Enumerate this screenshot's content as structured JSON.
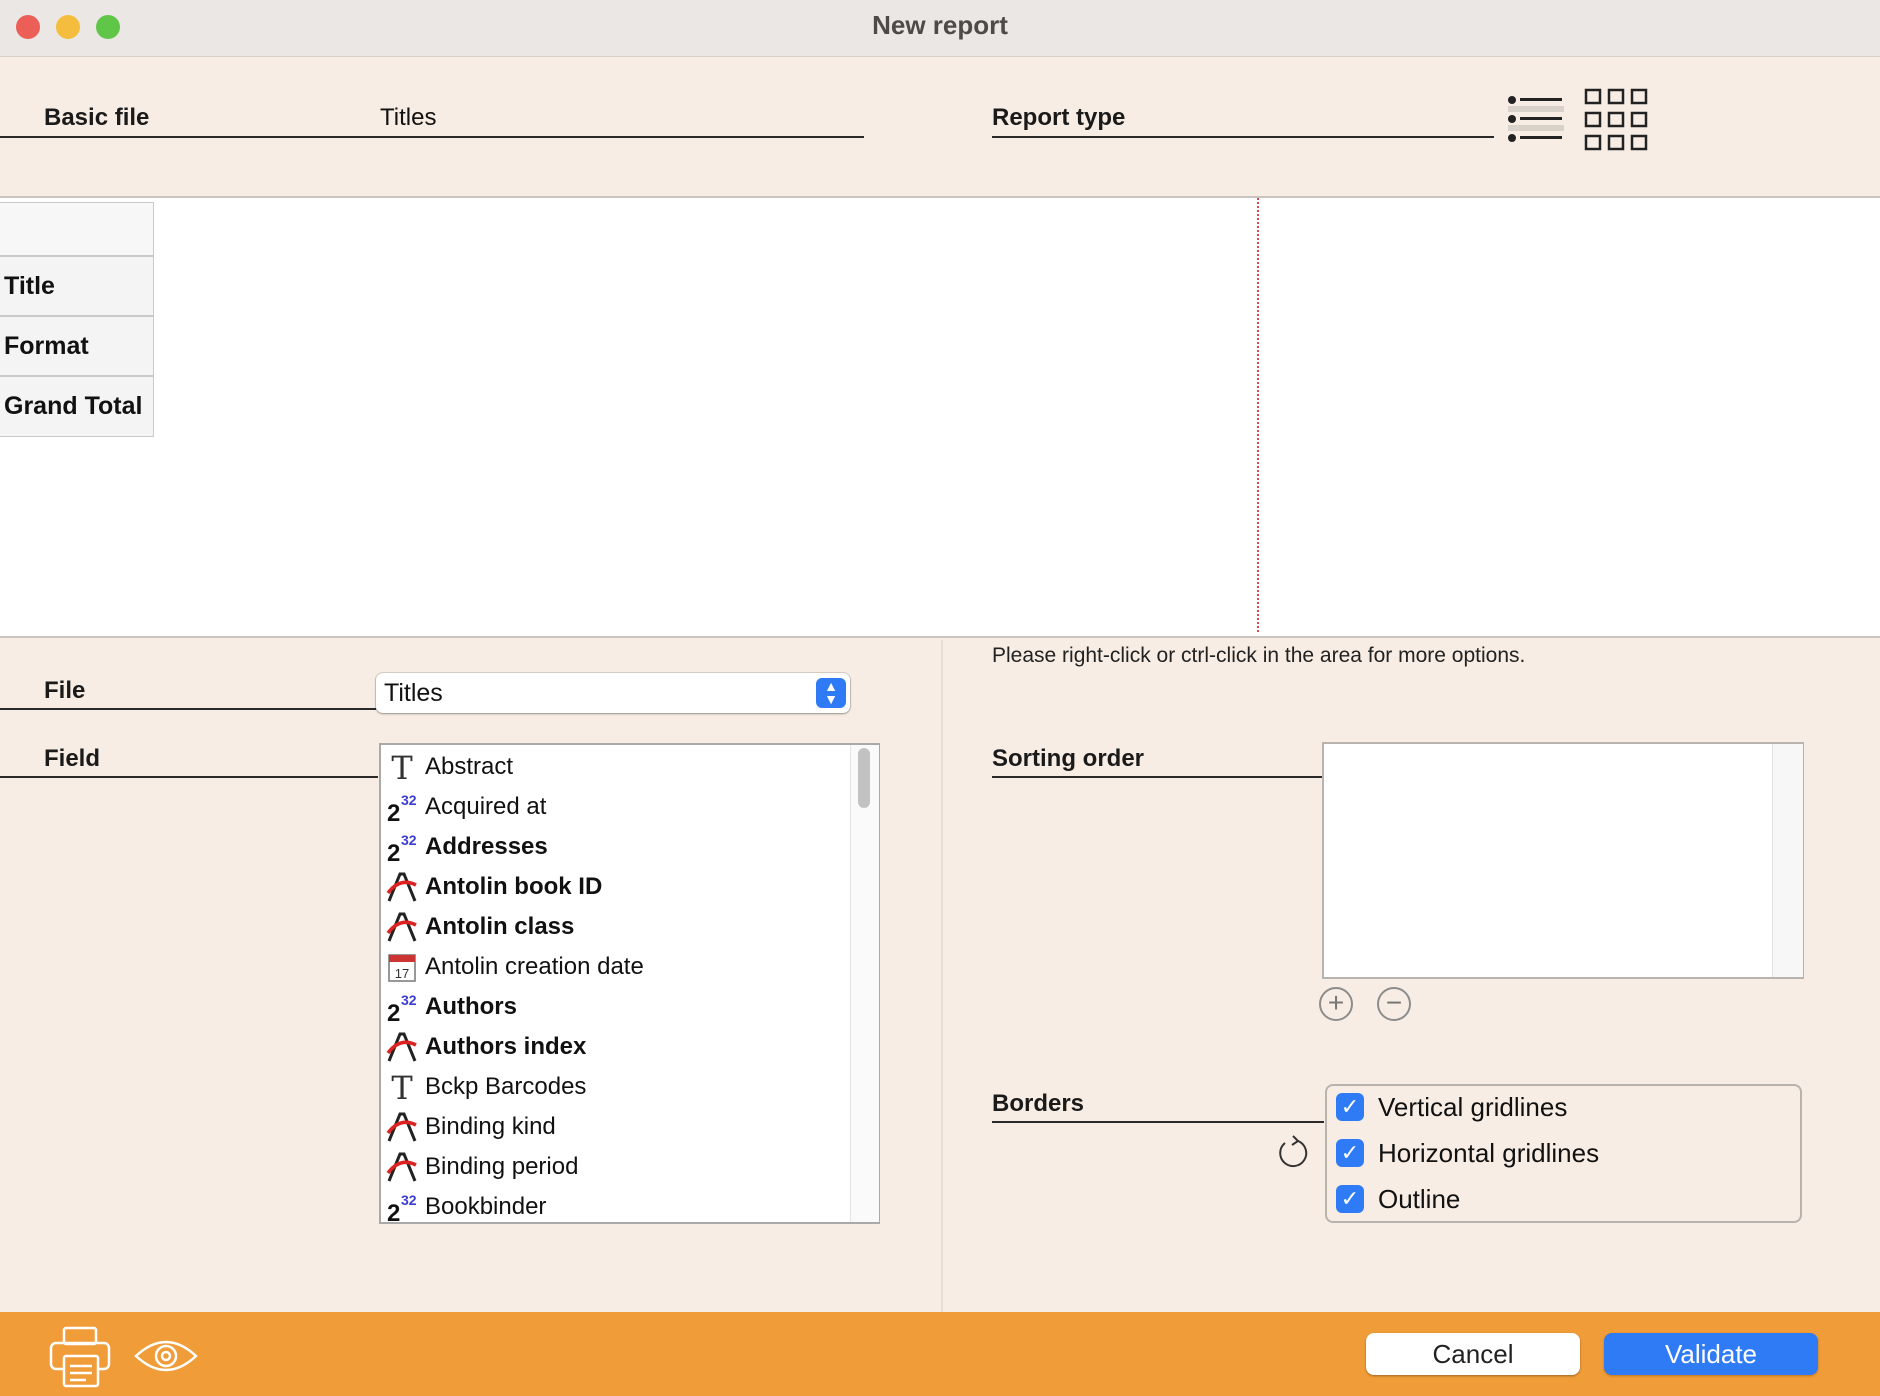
{
  "window": {
    "title": "New report"
  },
  "header": {
    "basic_file_label": "Basic file",
    "basic_file_value": "Titles",
    "report_type_label": "Report type",
    "report_type_icons": [
      "list-layout-icon",
      "grid-layout-icon"
    ]
  },
  "canvas": {
    "row_headers": [
      "Title",
      "Format",
      "Grand Total"
    ]
  },
  "hint": "Please right-click or ctrl-click in the area for more options.",
  "file": {
    "label": "File",
    "selected": "Titles"
  },
  "field": {
    "label": "Field",
    "items": [
      {
        "label": "Abstract",
        "icon": "text-icon",
        "bold": false
      },
      {
        "label": "Acquired at",
        "icon": "integer-icon",
        "bold": false
      },
      {
        "label": "Addresses",
        "icon": "integer-icon",
        "bold": true
      },
      {
        "label": "Antolin book ID",
        "icon": "alpha-icon",
        "bold": true
      },
      {
        "label": "Antolin class",
        "icon": "alpha-icon",
        "bold": true
      },
      {
        "label": "Antolin creation date",
        "icon": "date-icon",
        "bold": false
      },
      {
        "label": "Authors",
        "icon": "integer-icon",
        "bold": true
      },
      {
        "label": "Authors index",
        "icon": "alpha-icon",
        "bold": true
      },
      {
        "label": "Bckp Barcodes",
        "icon": "text-icon",
        "bold": false
      },
      {
        "label": "Binding kind",
        "icon": "alpha-icon",
        "bold": false
      },
      {
        "label": "Binding period",
        "icon": "alpha-icon",
        "bold": false
      },
      {
        "label": "Bookbinder",
        "icon": "integer-icon",
        "bold": false
      }
    ]
  },
  "sorting": {
    "label": "Sorting order",
    "add_symbol": "+",
    "remove_symbol": "−"
  },
  "borders": {
    "label": "Borders",
    "options": [
      {
        "label": "Vertical gridlines",
        "checked": true
      },
      {
        "label": "Horizontal gridlines",
        "checked": true
      },
      {
        "label": "Outline",
        "checked": true
      }
    ]
  },
  "footer": {
    "cancel": "Cancel",
    "validate": "Validate"
  },
  "colors": {
    "accent": "#2f7bf5",
    "footer": "#f09c38",
    "background": "#f7ede4"
  }
}
